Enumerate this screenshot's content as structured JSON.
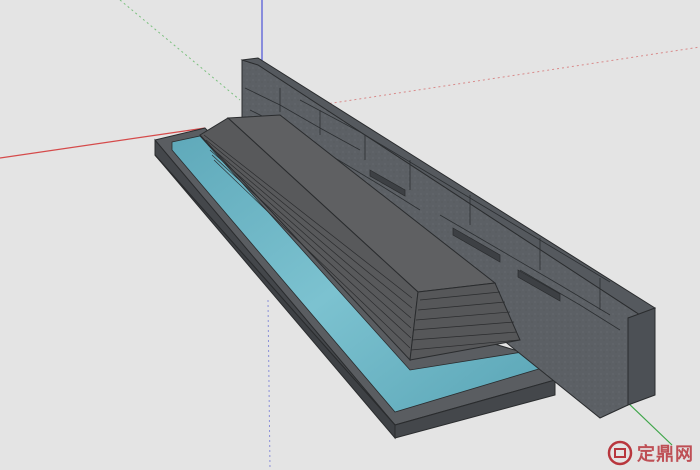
{
  "viewport": {
    "background": "#e4e4e4",
    "axes": {
      "red": "#d54a4a",
      "green": "#3fa64a",
      "blue": "#4a52d8"
    },
    "model": {
      "name": "waterscape-wall-with-stepped-pool",
      "wall_color": "#5d6166",
      "wall_top_color": "#55595e",
      "step_color": "#5f6062",
      "water_color": "#6fb4c4",
      "coping_color": "#5a5d61"
    }
  },
  "watermark": {
    "text": "定鼎网",
    "color": "#b8363d"
  }
}
